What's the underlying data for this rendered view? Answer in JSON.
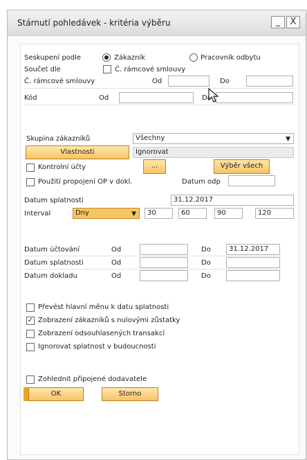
{
  "window": {
    "title": "Stárnutí pohledávek - kritéria výběru",
    "minimize": "_",
    "close": "X"
  },
  "grouping": {
    "label": "Seskupení podle",
    "opt_customer": "Zákazník",
    "opt_employee": "Pracovník odbytu"
  },
  "sum": {
    "label": "Součet dle",
    "option": "Č. rámcové smlouvy"
  },
  "contract": {
    "label": "Č. rámcové smlouvy",
    "from": "Od",
    "to": "Do",
    "from_value": "",
    "to_value": ""
  },
  "code": {
    "label": "Kód",
    "from": "Od",
    "to": "Do",
    "from_value": "",
    "to_value": ""
  },
  "group": {
    "label": "Skupina zákazníků",
    "value": "Všechny"
  },
  "properties": {
    "button": "Vlastnosti",
    "value": "Ignorovat"
  },
  "control": {
    "label": "Kontrolní účty",
    "dots": "...",
    "select_all": "Výběr všech"
  },
  "link": {
    "label": "Použití propojení OP v dokl.",
    "date_label": "Datum odp",
    "date_value": ""
  },
  "due": {
    "label": "Datum splatnosti",
    "value": "31.12.2017"
  },
  "interval": {
    "label": "Interval",
    "unit": "Dny",
    "values": [
      "30",
      "60",
      "90",
      "120"
    ]
  },
  "dates": {
    "from": "Od",
    "to": "Do",
    "posting": {
      "label": "Datum účtování",
      "from_value": "",
      "to_value": "31.12.2017"
    },
    "due": {
      "label": "Datum splatnosti",
      "from_value": "",
      "to_value": ""
    },
    "document": {
      "label": "Datum dokladu",
      "from_value": "",
      "to_value": ""
    }
  },
  "options": {
    "convert": "Převést hlavní měnu k datu splatnosti",
    "zero": "Zobrazení zákazníků s nulovými zůstatky",
    "reconciled": "Zobrazení odsouhlasených transakcí",
    "ignore_future": "Ignorovat splatnost v budoucnosti",
    "vendors": "Zohlednit připojené dodavatele",
    "checked_mark": "✓"
  },
  "buttons": {
    "ok": "OK",
    "cancel": "Storno"
  }
}
